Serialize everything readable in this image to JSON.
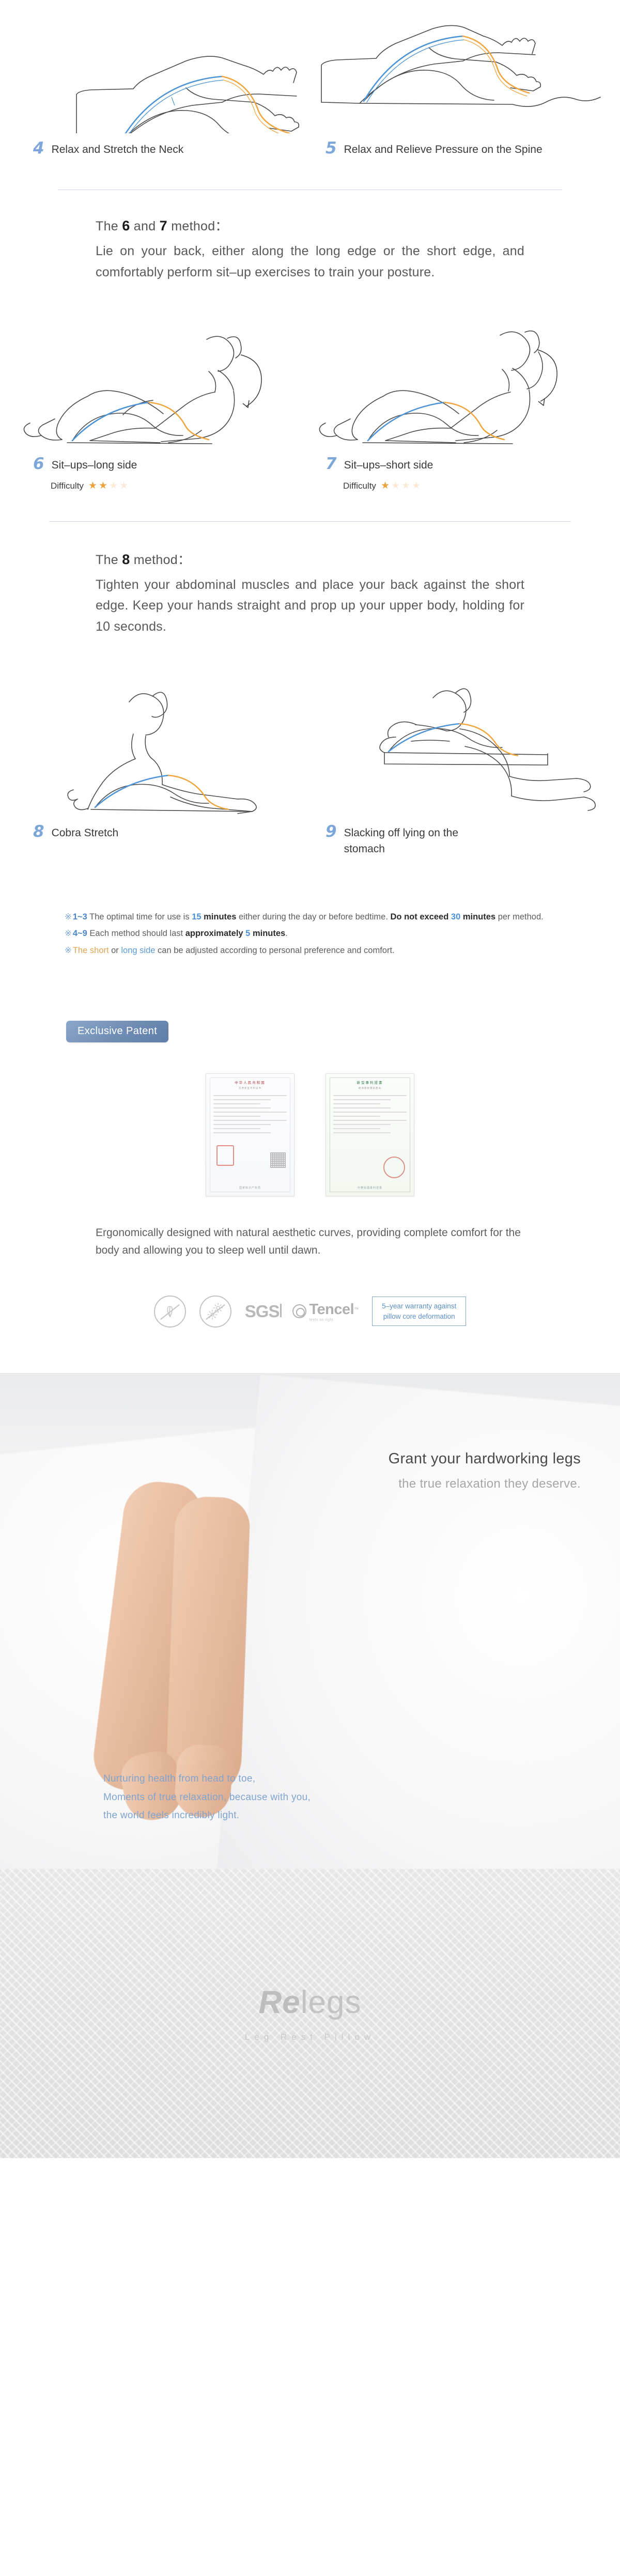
{
  "steps_45": [
    {
      "num": "4",
      "label": "Relax and Stretch the Neck"
    },
    {
      "num": "5",
      "label": "Relax and Relieve Pressure on the Spine"
    }
  ],
  "method67": {
    "title_prefix": "The ",
    "title_num_a": "6",
    "title_mid": " and ",
    "title_num_b": "7",
    "title_suffix": " method：",
    "body": "Lie on your back, either along the long edge or the short edge, and comfortably perform sit–up exercises to train your posture."
  },
  "steps_67": [
    {
      "num": "6",
      "label": "Sit–ups–long side",
      "difficulty_label": "Difficulty",
      "difficulty": 2,
      "difficulty_max": 4
    },
    {
      "num": "7",
      "label": "Sit–ups–short side",
      "difficulty_label": "Difficulty",
      "difficulty": 1,
      "difficulty_max": 4
    }
  ],
  "method8": {
    "title_prefix": "The ",
    "title_num": "8",
    "title_suffix": " method：",
    "body": "Tighten your abdominal muscles and place your back against the short edge. Keep your hands straight and prop up your upper body, holding for 10 seconds."
  },
  "steps_89": [
    {
      "num": "8",
      "label": "Cobra Stretch"
    },
    {
      "num": "9",
      "label": "Slacking off lying on the stomach"
    }
  ],
  "notes": {
    "n1": {
      "mark": "※",
      "range": "1~3",
      "t1": " The optimal time for use is ",
      "v1": "15",
      "b1": " minutes",
      "t2": " either during the day or before bedtime. ",
      "b2": "Do not exceed ",
      "v2": "30",
      "b3": " minutes",
      "t3": " per method."
    },
    "n2": {
      "mark": "※",
      "range": "4~9",
      "t1": " Each method should last ",
      "b1": "approximately ",
      "v1": "5",
      "b2": " minutes",
      "t2": "."
    },
    "n3": {
      "mark": "※",
      "orange": "The short",
      "mid": " or ",
      "blue": "long side",
      "tail": " can be adjusted according to personal preference and comfort."
    }
  },
  "patent": {
    "badge_label": "Exclusive Patent",
    "certificates": [
      {
        "name": "china-patent-certificate",
        "head": "中华人民共和国",
        "sub": "实用新型专利证书",
        "sign": "国家知识产权局"
      },
      {
        "name": "taiwan-patent-certificate",
        "head": "新型專利證書",
        "sub": "經濟部智慧財產局",
        "sign": "中華民國專利證書"
      }
    ],
    "description": "Ergonomically designed with natural aesthetic curves, providing complete comfort for the body and allowing you to sleep well until dawn."
  },
  "features": [
    {
      "name": "anti-mold-icon",
      "glyph": "🌿"
    },
    {
      "name": "anti-mite-icon",
      "glyph": "✳"
    },
    {
      "name": "sgs-logo",
      "label": "SGS"
    },
    {
      "name": "tencel-logo",
      "label": "Tencel",
      "tm": "™",
      "tagline": "feels so right"
    }
  ],
  "warranty": {
    "line1": "5–year warranty against",
    "line2": "pillow core deformation"
  },
  "hero": {
    "title_line1": "Grant your hardworking legs",
    "title_line2": "the true relaxation they deserve.",
    "footer_line1": "Nurturing health from head to toe,",
    "footer_line2": "Moments of true relaxation, because with you,",
    "footer_line3": "the world feels incredibly light."
  },
  "brand": {
    "logo_italic": "Re",
    "logo_rest": "legs",
    "tagline": "Leg Rest Pillow"
  },
  "colors": {
    "accent_blue": "#7da7d9",
    "star_on": "#eda13c",
    "star_off": "#fbead5",
    "note_orange": "#e0a551",
    "divider": "#cfd8e4"
  }
}
